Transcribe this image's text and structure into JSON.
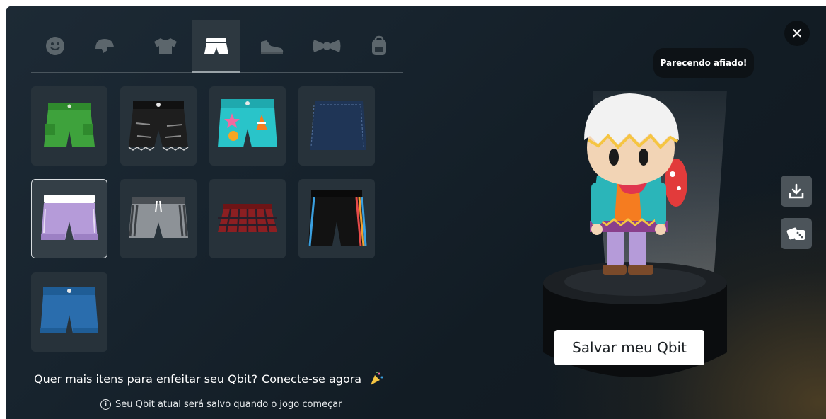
{
  "tabs": [
    {
      "name": "face-icon"
    },
    {
      "name": "helmet-icon"
    },
    {
      "name": "shirt-icon"
    },
    {
      "name": "shorts-icon"
    },
    {
      "name": "shoe-icon"
    },
    {
      "name": "bowtie-icon"
    },
    {
      "name": "backpack-icon"
    }
  ],
  "active_tab": 3,
  "items": [
    {
      "name": "green-cargo-shorts",
      "color": "#3ea23c"
    },
    {
      "name": "black-ripped-shorts",
      "color": "#1c1c1c"
    },
    {
      "name": "teal-sticker-shorts",
      "color": "#29c4c9"
    },
    {
      "name": "navy-denim-skirt",
      "color": "#1f3556"
    },
    {
      "name": "lilac-jogger-shorts",
      "color": "#b59bd9",
      "selected": true
    },
    {
      "name": "grey-sport-shorts",
      "color": "#8d9297"
    },
    {
      "name": "plaid-mini-skirt",
      "color": "#8c1f22"
    },
    {
      "name": "black-rainbow-stripe-shorts",
      "color": "#121212"
    },
    {
      "name": "blue-denim-shorts",
      "color": "#2a6dad"
    }
  ],
  "footer": {
    "promo_text": "Quer mais itens para enfeitar seu Qbit?",
    "promo_link": "Conecte-se agora",
    "note": "Seu Qbit atual será salvo quando o jogo começar"
  },
  "preview": {
    "bubble": "Parecendo afiado!",
    "save_label": "Salvar meu Qbit",
    "close_label": "✕"
  },
  "side_icons": [
    "download-icon",
    "dice-icon"
  ],
  "colors": {
    "accent": "#ffffff",
    "panel": "#27323a"
  }
}
